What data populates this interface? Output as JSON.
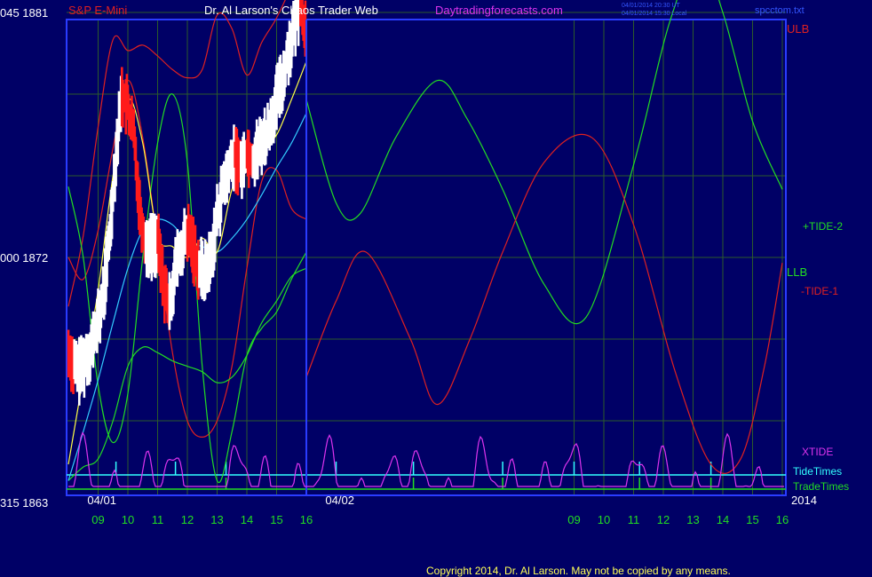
{
  "header": {
    "symbol": "S&P E-Mini",
    "author": "Dr. Al Larson's Chaos Trader Web",
    "site": "Daytradingforecasts.com",
    "stamp_ut": "04/01/2014 20:30 UT",
    "stamp_local": "04/01/2014 15:30 Local",
    "file": "spcctom.txt"
  },
  "footer": {
    "copyright": "Copyright 2014, Dr. Al Larson. May not be copied by any means."
  },
  "colors": {
    "background": "#000066",
    "frame": "#2a3cff",
    "grid": "#2b5a2b",
    "price_up": "#ffffff",
    "price_down": "#ff1a1a",
    "ma_slow": "#33ccff",
    "ma_fast": "#ffff44",
    "ulb": "#e02020",
    "llb": "#22dd22",
    "tide_pos": "#22dd22",
    "tide_neg": "#e02020",
    "xtide": "#dd33ee",
    "tidetimes": "#33ffff",
    "tradetimes": "#22dd22"
  },
  "chart_data": {
    "type": "line",
    "y_left_labels": [
      {
        "text": "045  1881",
        "value": 1881
      },
      {
        "text": "000  1872",
        "value": 1872
      },
      {
        "text": "315  1863",
        "value": 1863
      }
    ],
    "ylim": [
      1863,
      1881
    ],
    "x_tick_labels": [
      "09",
      "10",
      "11",
      "12",
      "13",
      "14",
      "15",
      "16",
      "09",
      "10",
      "11",
      "12",
      "13",
      "14",
      "15",
      "16"
    ],
    "x_tick_hours": [
      9,
      10,
      11,
      12,
      13,
      14,
      15,
      16,
      25,
      26,
      27,
      28,
      29,
      30,
      31,
      32
    ],
    "xlim": [
      8.0,
      32.0
    ],
    "date_labels": [
      {
        "text": "04/01",
        "hour": 8.4
      },
      {
        "text": "04/02",
        "hour": 16.4
      }
    ],
    "year_label": "2014",
    "now_hour": 16.0,
    "right_labels": {
      "ulb": "ULB",
      "tide2": "+TIDE-2",
      "llb": "LLB",
      "tide1": "-TIDE-1",
      "xtide": "XTIDE",
      "tidetimes": "TideTimes",
      "tradetimes": "TradeTimes"
    },
    "price_bars": {
      "hours": [
        8.0,
        8.2,
        8.4,
        8.6,
        8.8,
        9.0,
        9.2,
        9.4,
        9.6,
        9.8,
        10.0,
        10.2,
        10.4,
        10.6,
        10.8,
        11.0,
        11.2,
        11.4,
        11.6,
        11.8,
        12.0,
        12.2,
        12.4,
        12.6,
        12.8,
        13.0,
        13.2,
        13.4,
        13.6,
        13.8,
        14.0,
        14.2,
        14.4,
        14.6,
        14.8,
        15.0,
        15.2,
        15.4,
        15.6,
        15.8,
        16.0
      ],
      "close": [
        1868.5,
        1868.0,
        1867.8,
        1868.3,
        1868.8,
        1869.6,
        1870.8,
        1873.0,
        1875.8,
        1878.0,
        1877.5,
        1876.5,
        1873.8,
        1872.5,
        1872.4,
        1872.6,
        1871.0,
        1870.2,
        1871.6,
        1872.3,
        1872.9,
        1872.3,
        1871.6,
        1871.4,
        1872.0,
        1873.5,
        1874.6,
        1875.2,
        1875.7,
        1875.3,
        1875.9,
        1875.6,
        1876.0,
        1876.4,
        1876.8,
        1877.8,
        1878.5,
        1879.6,
        1880.4,
        1881.4,
        1880.2
      ]
    },
    "series": [
      {
        "key": "ulb",
        "hours": [
          8.0,
          8.5,
          9.0,
          9.5,
          10.0,
          10.5,
          11.0,
          11.5,
          12.0,
          12.5,
          13.0,
          13.5,
          14.0,
          14.5,
          15.0,
          15.5,
          16.0
        ],
        "values": [
          1870.2,
          1872.8,
          1876.8,
          1880.0,
          1879.6,
          1879.8,
          1879.4,
          1878.9,
          1878.6,
          1878.9,
          1880.9,
          1880.4,
          1878.7,
          1879.9,
          1880.8,
          1882.0,
          1883.5
        ]
      },
      {
        "key": "ulb_inner",
        "hours": [
          8.0,
          8.5,
          9.0,
          9.5,
          10.0,
          10.5,
          11.0,
          11.5,
          12.0,
          12.5,
          13.0,
          13.5,
          14.0,
          14.5,
          15.0,
          15.5,
          16.0
        ],
        "values": [
          1872.0,
          1871.2,
          1873.0,
          1876.0,
          1878.5,
          1876.4,
          1872.5,
          1868.5,
          1866.0,
          1865.4,
          1866.0,
          1868.0,
          1871.6,
          1874.8,
          1875.2,
          1873.8,
          1873.4
        ]
      },
      {
        "key": "llb",
        "hours": [
          8.0,
          8.5,
          9.0,
          9.5,
          10.0,
          10.5,
          11.0,
          11.5,
          12.0,
          12.5,
          13.0,
          13.5,
          14.0,
          14.5,
          15.0,
          15.5,
          16.0
        ],
        "values": [
          1863.8,
          1864.3,
          1864.6,
          1866.0,
          1868.0,
          1868.7,
          1868.5,
          1868.2,
          1868.0,
          1867.8,
          1867.4,
          1867.6,
          1868.4,
          1869.6,
          1870.4,
          1871.3,
          1871.6
        ]
      },
      {
        "key": "llb_inner",
        "hours": [
          8.0,
          8.5,
          9.0,
          9.5,
          10.0,
          10.5,
          11.0,
          11.5,
          12.0,
          12.5,
          13.0,
          13.5,
          14.0,
          14.5,
          15.0,
          15.5,
          16.0
        ],
        "values": [
          1874.6,
          1872.0,
          1867.3,
          1865.2,
          1867.0,
          1872.0,
          1876.2,
          1878.0,
          1875.5,
          1868.0,
          1863.8,
          1865.6,
          1868.4,
          1869.4,
          1870.0,
          1871.2,
          1872.2
        ]
      },
      {
        "key": "tide_pos",
        "hours": [
          16.0,
          17.0,
          17.8,
          19.0,
          20.4,
          21.4,
          22.6,
          24.0,
          25.4,
          27.0,
          28.2,
          29.2,
          30.0,
          31.0,
          32.0
        ],
        "values": [
          1877.8,
          1874.0,
          1873.6,
          1876.4,
          1878.5,
          1877.1,
          1874.5,
          1871.0,
          1869.8,
          1875.4,
          1880.6,
          1883.0,
          1881.0,
          1877.0,
          1874.5
        ]
      },
      {
        "key": "tide_neg",
        "hours": [
          16.0,
          17.0,
          18.0,
          19.5,
          20.4,
          21.5,
          22.6,
          24.0,
          25.6,
          27.0,
          28.4,
          29.6,
          30.6,
          31.4,
          32.0
        ],
        "values": [
          1867.6,
          1870.4,
          1872.2,
          1869.0,
          1866.6,
          1869.0,
          1872.2,
          1875.5,
          1876.4,
          1873.2,
          1867.8,
          1864.4,
          1864.6,
          1868.0,
          1871.8
        ]
      },
      {
        "key": "ma_slow",
        "hours": [
          8.0,
          8.5,
          9.0,
          9.5,
          10.0,
          10.5,
          11.0,
          11.5,
          12.0,
          12.5,
          13.0,
          13.5,
          14.0,
          14.5,
          15.0,
          15.5,
          16.0
        ],
        "values": [
          1863.8,
          1865.6,
          1867.5,
          1869.6,
          1871.6,
          1873.0,
          1873.4,
          1873.2,
          1872.6,
          1872.4,
          1872.2,
          1872.7,
          1873.4,
          1874.3,
          1875.3,
          1876.2,
          1877.3
        ]
      },
      {
        "key": "ma_fast",
        "hours": [
          8.0,
          8.5,
          9.0,
          9.5,
          10.0,
          10.5,
          11.0,
          11.5,
          12.0,
          12.5,
          13.0,
          13.5,
          14.0,
          14.5,
          15.0,
          15.5,
          16.0
        ],
        "values": [
          1864.4,
          1867.6,
          1870.8,
          1875.0,
          1877.8,
          1876.2,
          1872.8,
          1872.4,
          1872.0,
          1872.7,
          1872.2,
          1874.5,
          1875.6,
          1876.0,
          1876.5,
          1877.8,
          1879.2
        ]
      }
    ],
    "tide_times_hours": [
      9.6,
      11.6,
      13.3,
      17.0,
      19.6,
      22.6,
      25.0,
      27.2,
      29.6
    ],
    "trade_times_hours": [
      13.3,
      19.6,
      22.6,
      27.2,
      29.6
    ]
  }
}
